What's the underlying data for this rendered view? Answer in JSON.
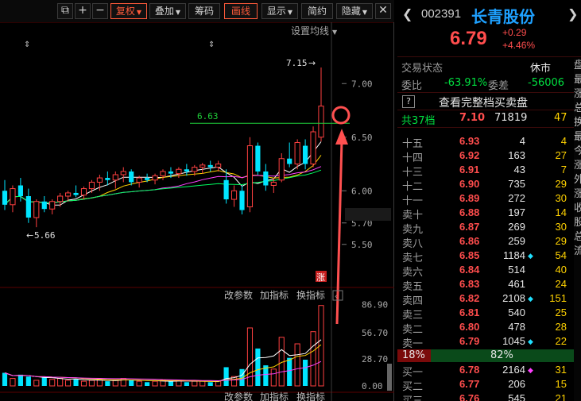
{
  "toolbar": {
    "restore_label": "复权",
    "overlay_label": "叠加",
    "chips_label": "筹码",
    "draw_label": "画线",
    "display_label": "显示",
    "simple_label": "简约",
    "hide_label": "隐藏"
  },
  "chart_labels": {
    "settings_ma": "设置均线",
    "high_label": "7.15",
    "low_label": "5.66",
    "line_label": "6.63",
    "y_ticks": [
      "7.00",
      "6.50",
      "6.00",
      "5.70",
      "5.50"
    ],
    "limit_badge": "涨",
    "indicator_change_params": "改参数",
    "indicator_add": "加指标",
    "indicator_switch": "换指标",
    "vol_ticks": [
      "86.90",
      "56.70",
      "28.70",
      "0.00"
    ],
    "bottom_labels": [
      "改参数",
      "加指标",
      "换指标"
    ]
  },
  "chart_data": {
    "type": "candlestick",
    "price_axis": {
      "min": 5.35,
      "max": 7.35,
      "ticks": [
        7.0,
        6.5,
        6.0,
        5.7,
        5.5
      ],
      "current": 5.7
    },
    "high_marker": 7.15,
    "low_marker": 5.66,
    "horizontal_line": 6.63,
    "candles": [
      {
        "o": 6.0,
        "h": 6.1,
        "l": 5.82,
        "c": 5.87,
        "up": false
      },
      {
        "o": 5.87,
        "h": 6.05,
        "l": 5.8,
        "c": 6.02,
        "up": true
      },
      {
        "o": 6.05,
        "h": 6.12,
        "l": 5.9,
        "c": 5.95,
        "up": false
      },
      {
        "o": 5.95,
        "h": 6.02,
        "l": 5.7,
        "c": 5.75,
        "up": false
      },
      {
        "o": 5.75,
        "h": 5.92,
        "l": 5.66,
        "c": 5.9,
        "up": true
      },
      {
        "o": 5.9,
        "h": 5.95,
        "l": 5.8,
        "c": 5.83,
        "up": false
      },
      {
        "o": 5.83,
        "h": 5.92,
        "l": 5.78,
        "c": 5.9,
        "up": true
      },
      {
        "o": 5.9,
        "h": 5.98,
        "l": 5.85,
        "c": 5.95,
        "up": true
      },
      {
        "o": 5.95,
        "h": 6.0,
        "l": 5.9,
        "c": 5.98,
        "up": true
      },
      {
        "o": 5.98,
        "h": 6.05,
        "l": 5.94,
        "c": 5.96,
        "up": false
      },
      {
        "o": 5.96,
        "h": 6.04,
        "l": 5.92,
        "c": 6.02,
        "up": true
      },
      {
        "o": 6.02,
        "h": 6.1,
        "l": 5.98,
        "c": 6.08,
        "up": true
      },
      {
        "o": 6.08,
        "h": 6.15,
        "l": 6.0,
        "c": 6.12,
        "up": true
      },
      {
        "o": 6.12,
        "h": 6.18,
        "l": 6.05,
        "c": 6.1,
        "up": false
      },
      {
        "o": 6.1,
        "h": 6.18,
        "l": 6.02,
        "c": 6.15,
        "up": true
      },
      {
        "o": 6.15,
        "h": 6.22,
        "l": 6.08,
        "c": 6.18,
        "up": true
      },
      {
        "o": 6.18,
        "h": 6.2,
        "l": 6.05,
        "c": 6.08,
        "up": false
      },
      {
        "o": 6.08,
        "h": 6.14,
        "l": 6.03,
        "c": 6.12,
        "up": true
      },
      {
        "o": 6.12,
        "h": 6.16,
        "l": 6.08,
        "c": 6.1,
        "up": false
      },
      {
        "o": 6.1,
        "h": 6.16,
        "l": 6.06,
        "c": 6.14,
        "up": true
      },
      {
        "o": 6.14,
        "h": 6.2,
        "l": 6.1,
        "c": 6.18,
        "up": true
      },
      {
        "o": 6.18,
        "h": 6.22,
        "l": 6.12,
        "c": 6.16,
        "up": false
      },
      {
        "o": 6.16,
        "h": 6.22,
        "l": 6.12,
        "c": 6.2,
        "up": true
      },
      {
        "o": 6.2,
        "h": 6.25,
        "l": 6.14,
        "c": 6.18,
        "up": false
      },
      {
        "o": 6.18,
        "h": 6.24,
        "l": 6.14,
        "c": 6.22,
        "up": true
      },
      {
        "o": 6.22,
        "h": 6.26,
        "l": 6.16,
        "c": 6.24,
        "up": true
      },
      {
        "o": 6.24,
        "h": 6.28,
        "l": 6.18,
        "c": 6.22,
        "up": false
      },
      {
        "o": 6.22,
        "h": 6.28,
        "l": 6.18,
        "c": 6.25,
        "up": true
      },
      {
        "o": 6.1,
        "h": 6.2,
        "l": 5.88,
        "c": 5.92,
        "up": false
      },
      {
        "o": 5.92,
        "h": 6.05,
        "l": 5.85,
        "c": 6.0,
        "up": true
      },
      {
        "o": 6.0,
        "h": 6.05,
        "l": 5.78,
        "c": 5.82,
        "up": false
      },
      {
        "o": 5.85,
        "h": 6.5,
        "l": 5.8,
        "c": 6.42,
        "up": true
      },
      {
        "o": 6.42,
        "h": 6.45,
        "l": 6.15,
        "c": 6.18,
        "up": false
      },
      {
        "o": 6.18,
        "h": 6.25,
        "l": 6.0,
        "c": 6.05,
        "up": false
      },
      {
        "o": 6.05,
        "h": 6.12,
        "l": 5.98,
        "c": 6.08,
        "up": true
      },
      {
        "o": 6.1,
        "h": 6.35,
        "l": 6.08,
        "c": 6.3,
        "up": true
      },
      {
        "o": 6.3,
        "h": 6.45,
        "l": 6.22,
        "c": 6.25,
        "up": false
      },
      {
        "o": 6.25,
        "h": 6.48,
        "l": 6.2,
        "c": 6.45,
        "up": true
      },
      {
        "o": 6.42,
        "h": 6.48,
        "l": 6.2,
        "c": 6.25,
        "up": false
      },
      {
        "o": 6.25,
        "h": 6.6,
        "l": 6.22,
        "c": 6.55,
        "up": true
      },
      {
        "o": 6.5,
        "h": 7.15,
        "l": 6.46,
        "c": 6.79,
        "up": true
      }
    ],
    "volume_axis": {
      "min": 0,
      "max": 90,
      "ticks": [
        86.9,
        56.7,
        28.7,
        0.0
      ]
    },
    "volumes": [
      14,
      8,
      12,
      10,
      6,
      9,
      7,
      8,
      6,
      7,
      5,
      6,
      7,
      5,
      6,
      8,
      6,
      5,
      4,
      5,
      6,
      5,
      6,
      4,
      5,
      5,
      4,
      5,
      20,
      10,
      18,
      62,
      40,
      22,
      18,
      52,
      30,
      45,
      28,
      58,
      86
    ]
  },
  "quote": {
    "code": "002391",
    "name": "长青股份",
    "price": "6.79",
    "change": "+0.29",
    "change_pct": "+4.46%",
    "status_label": "交易状态",
    "status_value": "休市",
    "wb_label": "委比",
    "wb_value": "-63.91%",
    "wc_label": "委差",
    "wc_value": "-56006",
    "view_full_label": "查看完整档买卖盘",
    "total_label": "共37档",
    "total_price": "7.10",
    "total_vol": "71819",
    "total_count": "47"
  },
  "order_book": {
    "sells": [
      {
        "name": "十五",
        "price": "6.93",
        "vol": "4",
        "mark": "",
        "chg": "4"
      },
      {
        "name": "十四",
        "price": "6.92",
        "vol": "163",
        "mark": "",
        "chg": "27"
      },
      {
        "name": "十三",
        "price": "6.91",
        "vol": "43",
        "mark": "",
        "chg": "7"
      },
      {
        "name": "十二",
        "price": "6.90",
        "vol": "735",
        "mark": "",
        "chg": "29"
      },
      {
        "name": "十一",
        "price": "6.89",
        "vol": "272",
        "mark": "",
        "chg": "30"
      },
      {
        "name": "卖十",
        "price": "6.88",
        "vol": "197",
        "mark": "",
        "chg": "14"
      },
      {
        "name": "卖九",
        "price": "6.87",
        "vol": "269",
        "mark": "",
        "chg": "30"
      },
      {
        "name": "卖八",
        "price": "6.86",
        "vol": "259",
        "mark": "",
        "chg": "29"
      },
      {
        "name": "卖七",
        "price": "6.85",
        "vol": "1184",
        "mark": "◆",
        "chg": "54"
      },
      {
        "name": "卖六",
        "price": "6.84",
        "vol": "514",
        "mark": "",
        "chg": "40"
      },
      {
        "name": "卖五",
        "price": "6.83",
        "vol": "461",
        "mark": "",
        "chg": "24"
      },
      {
        "name": "卖四",
        "price": "6.82",
        "vol": "2108",
        "mark": "◆",
        "chg": "151"
      },
      {
        "name": "卖三",
        "price": "6.81",
        "vol": "540",
        "mark": "",
        "chg": "25"
      },
      {
        "name": "卖二",
        "price": "6.80",
        "vol": "478",
        "mark": "",
        "chg": "28"
      },
      {
        "name": "卖一",
        "price": "6.79",
        "vol": "1045",
        "mark": "◆",
        "chg": "22"
      }
    ],
    "ratio_left": "18%",
    "ratio_right": "82%",
    "buys": [
      {
        "name": "买一",
        "price": "6.78",
        "vol": "2164",
        "mark": "◆",
        "chg": "31"
      },
      {
        "name": "买二",
        "price": "6.77",
        "vol": "206",
        "mark": "",
        "chg": "15"
      },
      {
        "name": "买三",
        "price": "6.76",
        "vol": "545",
        "mark": "",
        "chg": "21"
      }
    ]
  },
  "edge_column": [
    "盘",
    "最",
    "涨",
    "总",
    "换",
    "最",
    "今",
    "涨",
    "外",
    "涨",
    "收",
    "股",
    "总",
    "流"
  ],
  "colors": {
    "up": "#ff4040",
    "down": "#00e5ff",
    "ma1": "#ffffff",
    "ma2": "#ffd200",
    "ma3": "#ff40ff",
    "ma4": "#00ff60",
    "annotation": "#ff5050",
    "name_blue": "#1ea0ff"
  }
}
